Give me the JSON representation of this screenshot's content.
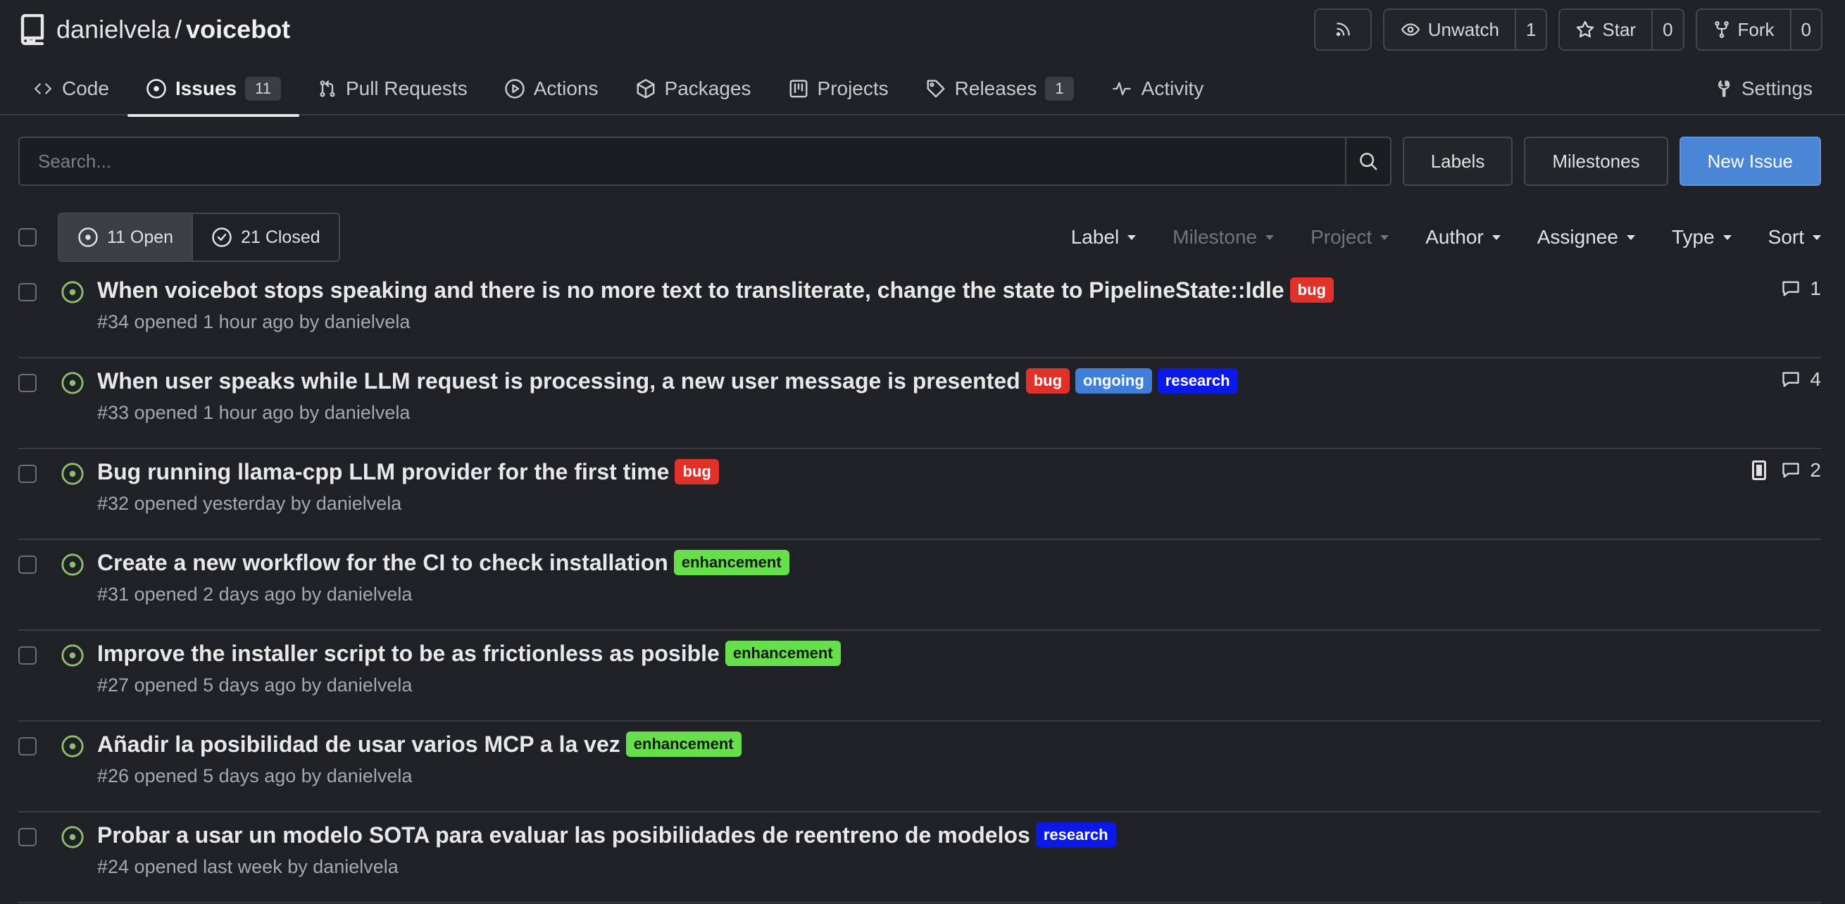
{
  "repo": {
    "owner": "danielvela",
    "separator": "/",
    "name": "voicebot"
  },
  "repo_actions": {
    "unwatch": {
      "label": "Unwatch",
      "count": "1"
    },
    "star": {
      "label": "Star",
      "count": "0"
    },
    "fork": {
      "label": "Fork",
      "count": "0"
    }
  },
  "tabs": [
    {
      "label": "Code"
    },
    {
      "label": "Issues",
      "count": "11"
    },
    {
      "label": "Pull Requests"
    },
    {
      "label": "Actions"
    },
    {
      "label": "Packages"
    },
    {
      "label": "Projects"
    },
    {
      "label": "Releases",
      "count": "1"
    },
    {
      "label": "Activity"
    },
    {
      "label": "Settings"
    }
  ],
  "toolbar": {
    "search_placeholder": "Search...",
    "labels": "Labels",
    "milestones": "Milestones",
    "new_issue": "New Issue"
  },
  "state_filter": {
    "open": "11 Open",
    "closed": "21 Closed"
  },
  "filters": [
    "Label",
    "Milestone",
    "Project",
    "Author",
    "Assignee",
    "Type",
    "Sort"
  ],
  "issues": [
    {
      "title": "When voicebot stops speaking and there is no more text to transliterate, change the state to PipelineState::Idle",
      "labels": [
        "bug"
      ],
      "meta": "#34 opened 1 hour ago by danielvela",
      "comments": "1"
    },
    {
      "title": "When user speaks while LLM request is processing, a new user message is presented",
      "labels": [
        "bug",
        "ongoing",
        "research"
      ],
      "meta": "#33 opened 1 hour ago by danielvela",
      "comments": "4"
    },
    {
      "title": "Bug running llama-cpp LLM provider for the first time",
      "labels": [
        "bug"
      ],
      "meta": "#32 opened yesterday by danielvela",
      "comments": "2"
    },
    {
      "title": "Create a new workflow for the CI to check installation",
      "labels": [
        "enhancement"
      ],
      "meta": "#31 opened 2 days ago by danielvela"
    },
    {
      "title": "Improve the installer script to be as frictionless as posible",
      "labels": [
        "enhancement"
      ],
      "meta": "#27 opened 5 days ago by danielvela"
    },
    {
      "title": "Añadir la posibilidad de usar varios MCP a la vez",
      "labels": [
        "enhancement"
      ],
      "meta": "#26 opened 5 days ago by danielvela"
    },
    {
      "title": "Probar a usar un modelo SOTA para evaluar las posibilidades de reentreno de modelos",
      "labels": [
        "research"
      ],
      "meta": "#24 opened last week by danielvela"
    }
  ]
}
